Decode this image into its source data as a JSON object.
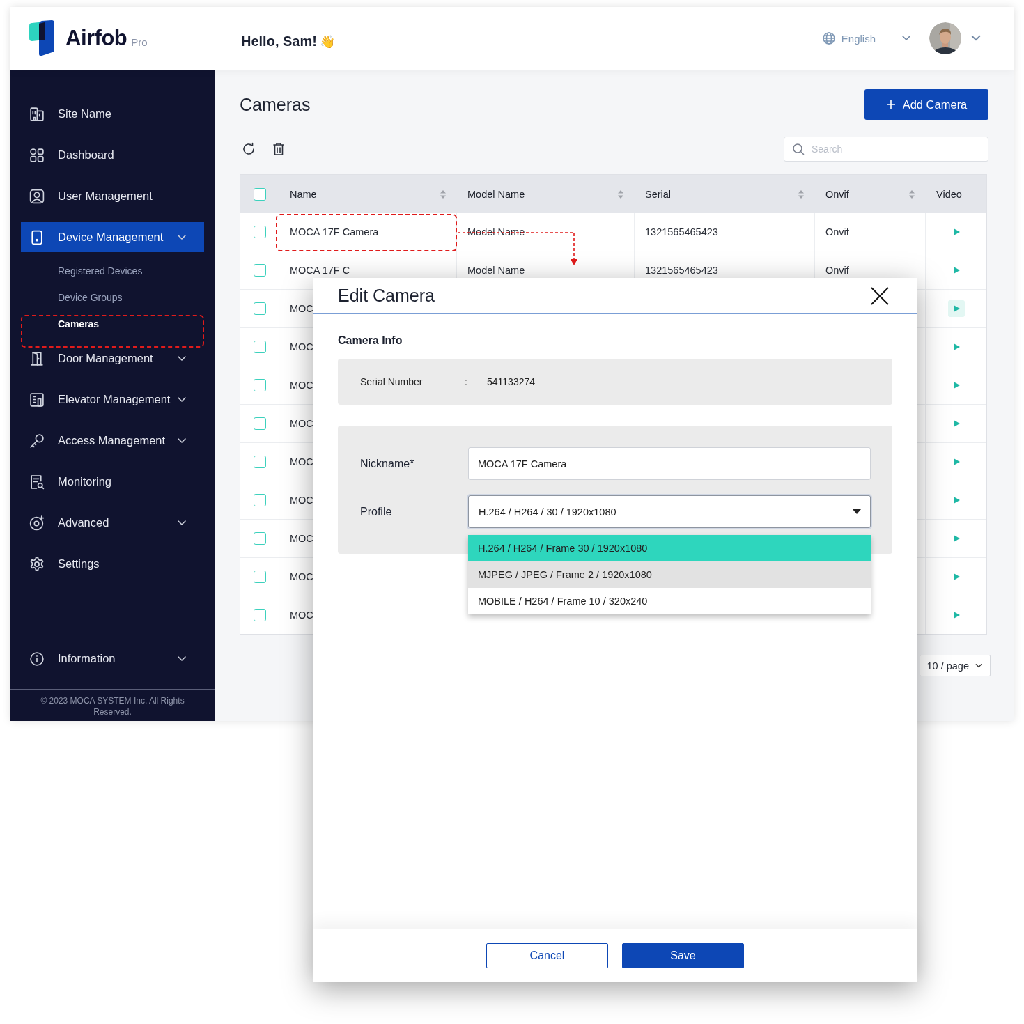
{
  "header": {
    "logo": {
      "name": "Airfob",
      "edition": "Pro"
    },
    "greeting": "Hello, Sam!",
    "greeting_emoji": "👋",
    "language": "English"
  },
  "sidebar": {
    "items": [
      {
        "label": "Site Name",
        "selected": false
      },
      {
        "label": "Dashboard",
        "selected": false
      },
      {
        "label": "User Management",
        "selected": false
      },
      {
        "label": "Device Management",
        "selected": true,
        "expanded": true,
        "children": [
          {
            "label": "Registered Devices",
            "selected": false
          },
          {
            "label": "Device Groups",
            "selected": false
          },
          {
            "label": "Cameras",
            "selected": true
          }
        ]
      },
      {
        "label": "Door Management",
        "selected": false,
        "expanded": false
      },
      {
        "label": "Elevator Management",
        "selected": false,
        "expanded": false
      },
      {
        "label": "Access Management",
        "selected": false,
        "expanded": false
      },
      {
        "label": "Monitoring",
        "selected": false
      },
      {
        "label": "Advanced",
        "selected": false,
        "expanded": false
      },
      {
        "label": "Settings",
        "selected": false
      }
    ],
    "footer_item": {
      "label": "Information",
      "expanded": false
    },
    "copyright": "© 2023 MOCA SYSTEM Inc. All Rights Reserved."
  },
  "page": {
    "title": "Cameras",
    "add_button": "Add Camera",
    "search": {
      "placeholder": "Search"
    }
  },
  "table": {
    "header_checked": false,
    "columns": [
      {
        "label": "Name",
        "sortable": true
      },
      {
        "label": "Model Name",
        "sortable": true
      },
      {
        "label": "Serial",
        "sortable": true
      },
      {
        "label": "Onvif",
        "sortable": true
      },
      {
        "label": "Video",
        "sortable": false
      }
    ],
    "rows": [
      {
        "checked": false,
        "hovered": false,
        "cells": [
          "MOCA 17F Camera",
          "Model Name",
          "1321565465423",
          "Onvif"
        ]
      },
      {
        "checked": false,
        "hovered": false,
        "cells": [
          "MOCA 17F C",
          "Model Name",
          "1321565465423",
          "Onvif"
        ]
      },
      {
        "checked": false,
        "hovered": true,
        "cells": [
          "MOC"
        ]
      },
      {
        "checked": false,
        "hovered": false,
        "cells": [
          "MOC"
        ]
      },
      {
        "checked": false,
        "hovered": false,
        "cells": [
          "MOC"
        ]
      },
      {
        "checked": false,
        "hovered": false,
        "cells": [
          "MOC"
        ]
      },
      {
        "checked": false,
        "hovered": false,
        "cells": [
          "MOC"
        ]
      },
      {
        "checked": false,
        "hovered": false,
        "cells": [
          "MOC"
        ]
      },
      {
        "checked": false,
        "hovered": false,
        "cells": [
          "MOC"
        ]
      },
      {
        "checked": false,
        "hovered": false,
        "cells": [
          "MOC"
        ]
      },
      {
        "checked": false,
        "hovered": false,
        "cells": [
          "MOC"
        ]
      }
    ]
  },
  "pagination": {
    "page_size": "10 / page"
  },
  "modal": {
    "title": "Edit Camera",
    "section": "Camera Info",
    "info": [
      {
        "label": "Serial Number",
        "separator": ":",
        "value": "541133274"
      }
    ],
    "fields": [
      {
        "kind": "text",
        "label": "Nickname*",
        "value": "MOCA 17F Camera"
      },
      {
        "kind": "select",
        "label": "Profile",
        "value": "H.264 / H264 / 30 / 1920x1080",
        "open": true,
        "options": [
          {
            "label": "H.264 / H264 / Frame 30 / 1920x1080",
            "selected": true,
            "hovered": false
          },
          {
            "label": "MJPEG / JPEG / Frame 2 / 1920x1080",
            "selected": false,
            "hovered": true
          },
          {
            "label": "MOBILE / H264 / Frame 10 / 320x240",
            "selected": false,
            "hovered": false
          }
        ]
      }
    ],
    "buttons": [
      {
        "label": "Cancel",
        "kind": "secondary"
      },
      {
        "label": "Save",
        "kind": "primary"
      }
    ]
  }
}
